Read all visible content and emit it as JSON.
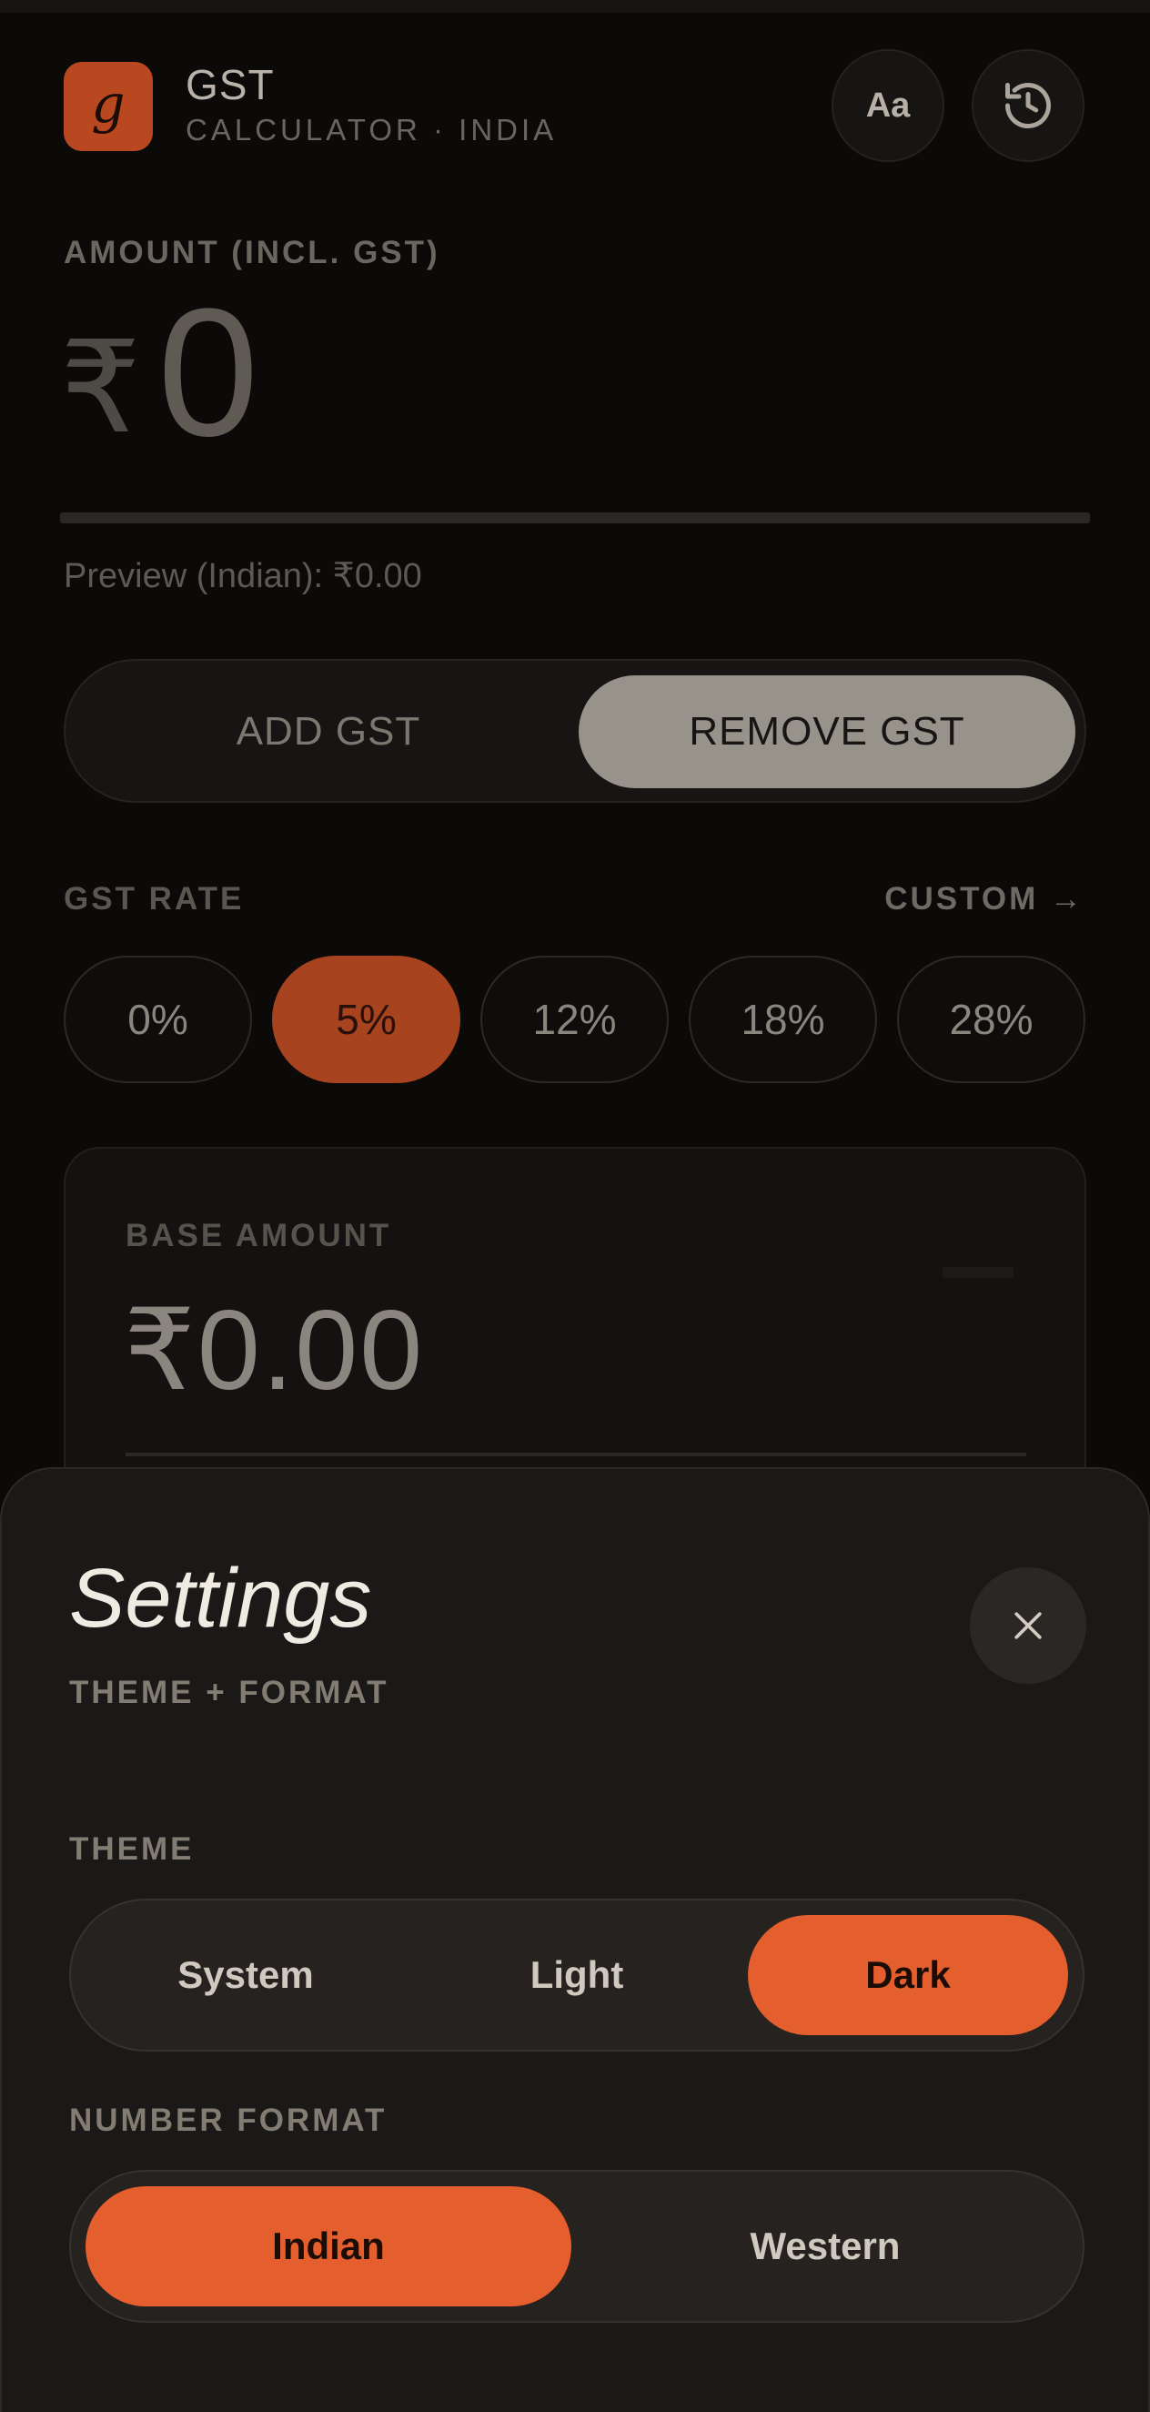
{
  "header": {
    "logo_letter": "g",
    "title": "GST",
    "subtitle": "CALCULATOR · INDIA",
    "font_button_label": "Aa",
    "history_icon": "history-icon"
  },
  "amount": {
    "label": "AMOUNT (INCL. GST)",
    "currency_symbol": "₹",
    "value": "0",
    "preview": "Preview (Indian): ₹0.00"
  },
  "mode": {
    "add_label": "ADD GST",
    "remove_label": "REMOVE GST",
    "selected": "REMOVE GST"
  },
  "rate": {
    "label": "GST RATE",
    "custom_label": "CUSTOM →",
    "options": [
      "0%",
      "5%",
      "12%",
      "18%",
      "28%"
    ],
    "selected": "5%"
  },
  "result": {
    "base_label": "BASE AMOUNT",
    "base_value": "₹0.00"
  },
  "settings": {
    "title": "Settings",
    "subtitle": "THEME + FORMAT",
    "close_icon": "close-icon",
    "theme_label": "THEME",
    "theme_options": [
      "System",
      "Light",
      "Dark"
    ],
    "theme_selected": "Dark",
    "format_label": "NUMBER FORMAT",
    "format_options": [
      "Indian",
      "Western"
    ],
    "format_selected": "Indian"
  },
  "colors": {
    "accent": "#e55e2d",
    "accent_dim": "#a8431f",
    "background": "#0b0a09",
    "sheet": "#1b1917"
  }
}
